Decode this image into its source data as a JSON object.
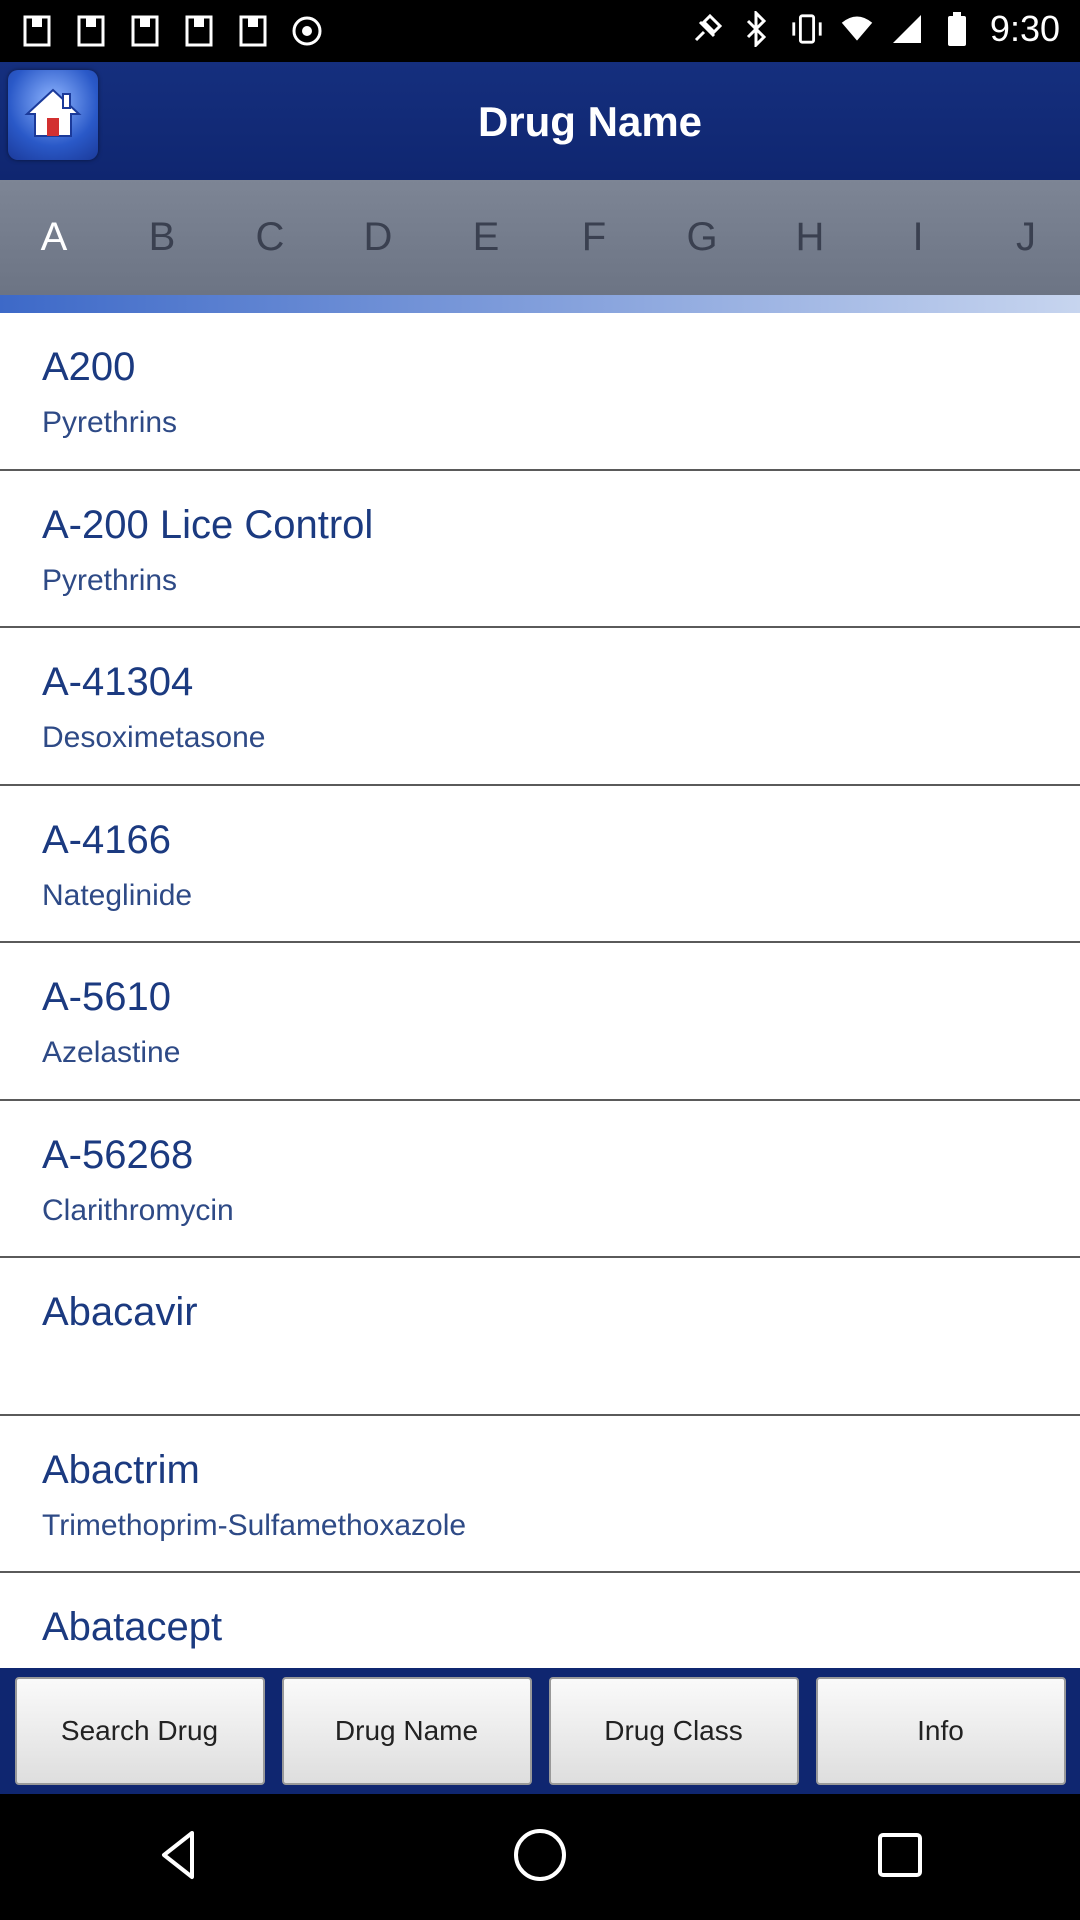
{
  "status_bar": {
    "time": "9:30",
    "left_icons": [
      "notification-icon",
      "notification-icon",
      "notification-icon",
      "notification-icon",
      "notification-icon",
      "notification-icon"
    ],
    "right_icons": [
      "gps-icon",
      "bluetooth-icon",
      "vibrate-icon",
      "wifi-icon",
      "signal-icon",
      "battery-icon"
    ]
  },
  "header": {
    "title": "Drug Name",
    "home_icon": "home-icon"
  },
  "alphabet": {
    "letters": [
      "A",
      "B",
      "C",
      "D",
      "E",
      "F",
      "G",
      "H",
      "I",
      "J"
    ],
    "active": "A"
  },
  "drugs": [
    {
      "name": "A200",
      "generic": "Pyrethrins"
    },
    {
      "name": "A-200 Lice Control",
      "generic": "Pyrethrins"
    },
    {
      "name": "A-41304",
      "generic": "Desoximetasone"
    },
    {
      "name": "A-4166",
      "generic": "Nateglinide"
    },
    {
      "name": "A-5610",
      "generic": "Azelastine"
    },
    {
      "name": "A-56268",
      "generic": "Clarithromycin"
    },
    {
      "name": "Abacavir",
      "generic": ""
    },
    {
      "name": "Abactrim",
      "generic": "Trimethoprim-Sulfamethoxazole"
    },
    {
      "name": "Abatacept",
      "generic": ""
    }
  ],
  "tabs": [
    {
      "label": "Search Drug"
    },
    {
      "label": "Drug Name"
    },
    {
      "label": "Drug Class"
    },
    {
      "label": "Info"
    }
  ],
  "colors": {
    "header_bg": "#0f2670",
    "alpha_bar_bg": "#757d8d",
    "list_text": "#1b3a80"
  }
}
